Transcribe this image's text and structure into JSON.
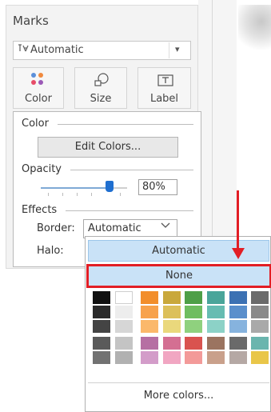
{
  "marks": {
    "title": "Marks",
    "mark_type": "Automatic",
    "buttons": [
      {
        "label": "Color",
        "icon": "color-dots-icon"
      },
      {
        "label": "Size",
        "icon": "size-shapes-icon"
      },
      {
        "label": "Label",
        "icon": "label-T-icon"
      }
    ]
  },
  "color_panel": {
    "color_heading": "Color",
    "edit_colors": "Edit Colors...",
    "opacity_heading": "Opacity",
    "opacity_value": "80%",
    "opacity_fraction": 0.8,
    "effects_heading": "Effects",
    "border_label": "Border:",
    "border_value": "Automatic",
    "halo_label": "Halo:"
  },
  "dropdown": {
    "option_automatic": "Automatic",
    "option_none": "None",
    "more_colors": "More colors...",
    "swatch_columns": [
      [
        "#111111",
        "#2b2b2b",
        "#444444",
        "#5a5a5a",
        "#727272"
      ],
      [
        "#ffffff",
        "#ededed",
        "#d6d6d6",
        "#c4c4c4",
        "#b1b1b1"
      ],
      [
        "#f28e2b",
        "#f7a24c",
        "#fbb86b",
        "#b66fa3",
        "#d39cc9"
      ],
      [
        "#c9a83b",
        "#dcc05a",
        "#ead87c",
        "#d46f92",
        "#f1a6c2"
      ],
      [
        "#4e9f47",
        "#6fbd60",
        "#8fd17e",
        "#d9534f",
        "#f39a99"
      ],
      [
        "#4aa59a",
        "#66bcb2",
        "#8cd2c7",
        "#9b7460",
        "#c9a08b"
      ],
      [
        "#3c71b3",
        "#5a8fcc",
        "#86b3de",
        "#6a6a6a",
        "#b5a8a4"
      ],
      [
        "#6b6b6b",
        "#8a8a8a",
        "#a9a9a9",
        "#6ab5ae",
        "#e9c649"
      ]
    ]
  },
  "colors": {
    "highlight": "#c9e2f7",
    "callout": "#e21e25",
    "slider": "#1f6fd0"
  }
}
